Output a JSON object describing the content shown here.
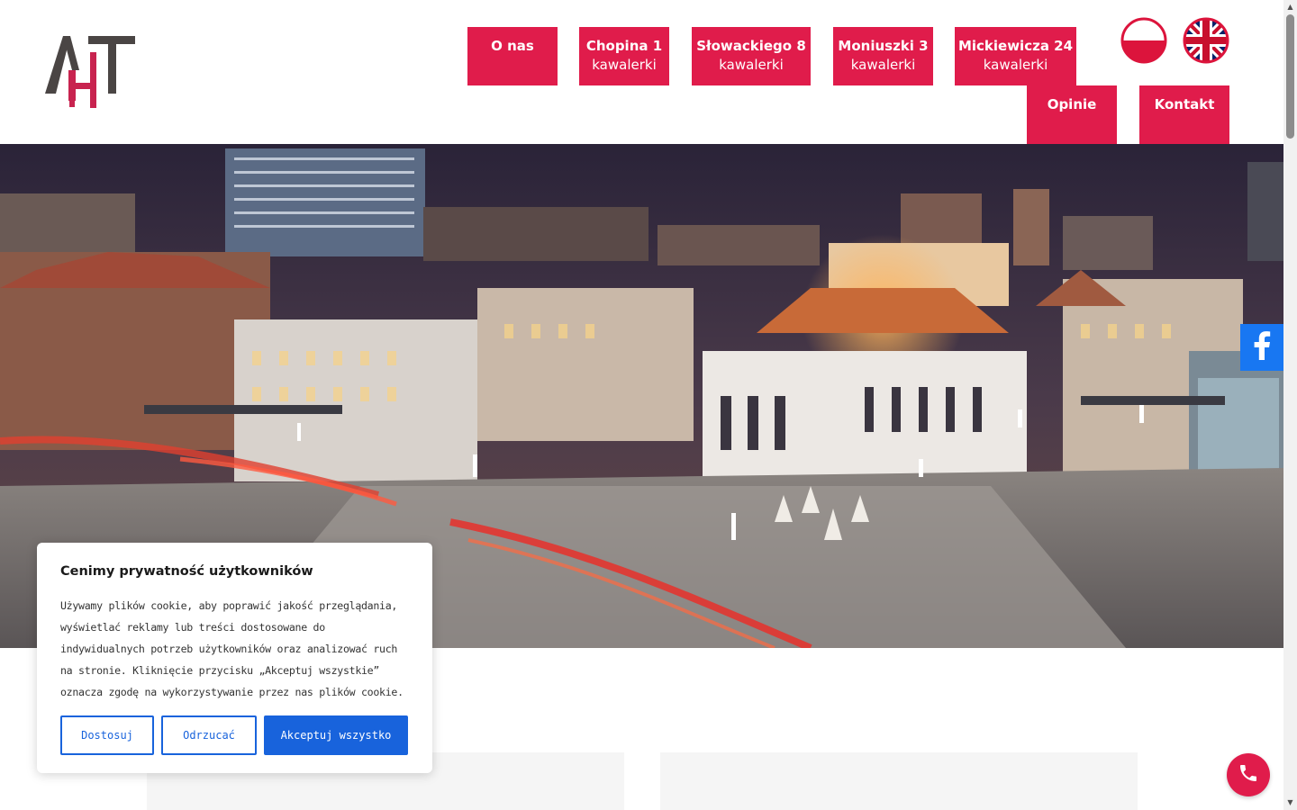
{
  "nav": {
    "items": [
      {
        "line1": "O nas",
        "line2": ""
      },
      {
        "line1": "Chopina 1",
        "line2": "kawalerki"
      },
      {
        "line1": "Słowackiego 8",
        "line2": "kawalerki"
      },
      {
        "line1": "Moniuszki 3",
        "line2": "kawalerki"
      },
      {
        "line1": "Mickiewicza 24",
        "line2": "kawalerki"
      },
      {
        "line1": "Opinie",
        "line2": ""
      },
      {
        "line1": "Kontakt",
        "line2": ""
      }
    ]
  },
  "languages": [
    "polish-flag-icon",
    "uk-flag-icon"
  ],
  "colors": {
    "accent": "#e01c4b",
    "cookie_button": "#1863dc",
    "facebook": "#1877f2"
  },
  "cookie": {
    "title": "Cenimy prywatność użytkowników",
    "body": "Używamy plików cookie, aby poprawić jakość przeglądania, wyświetlać reklamy lub treści dostosowane do indywidualnych potrzeb użytkowników oraz analizować ruch na stronie. Kliknięcie przycisku „Akceptuj wszystkie” oznacza zgodę na wykorzystywanie przez nas plików cookie.",
    "customize_label": "Dostosuj",
    "reject_label": "Odrzucać",
    "accept_label": "Akceptuj wszystko"
  }
}
